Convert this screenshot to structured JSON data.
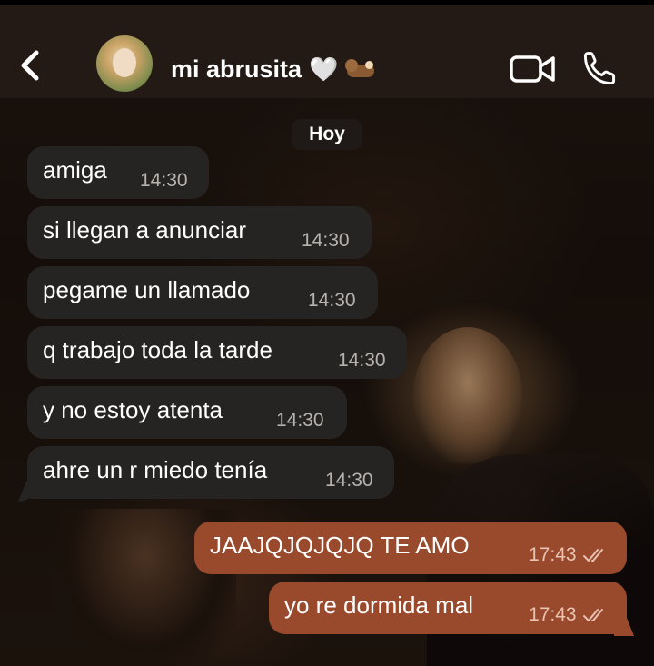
{
  "header": {
    "contact_name": "mi abrusita",
    "name_emoji": "🤍",
    "icons": [
      "back-arrow-icon",
      "video-call-icon",
      "phone-icon"
    ]
  },
  "date_separator": "Hoy",
  "messages": [
    {
      "direction": "incoming",
      "text": "amiga",
      "time": "14:30"
    },
    {
      "direction": "incoming",
      "text": "si llegan a anunciar",
      "time": "14:30"
    },
    {
      "direction": "incoming",
      "text": "pegame un llamado",
      "time": "14:30"
    },
    {
      "direction": "incoming",
      "text": "q trabajo toda la tarde",
      "time": "14:30"
    },
    {
      "direction": "incoming",
      "text": "y no estoy atenta",
      "time": "14:30"
    },
    {
      "direction": "incoming",
      "text": "ahre un r miedo tenía",
      "time": "14:30"
    },
    {
      "direction": "outgoing",
      "text": "JAAJQJQJQJQ TE AMO",
      "time": "17:43",
      "status": "read"
    },
    {
      "direction": "outgoing",
      "text": "yo re dormida mal",
      "time": "17:43",
      "status": "read"
    }
  ],
  "colors": {
    "header_bg": "#231a15",
    "incoming_bubble": "#262423",
    "outgoing_bubble": "#9a4a2c",
    "text": "#ffffff"
  }
}
